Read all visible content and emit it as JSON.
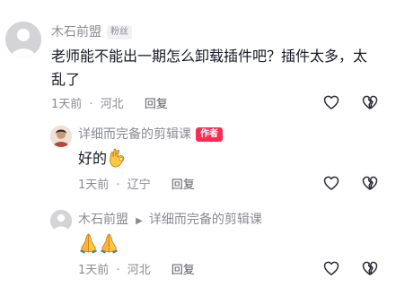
{
  "comments": [
    {
      "user": "木石前盟",
      "badge": "粉丝",
      "text_line1": "老师能不能出一期怎么卸载插件吧？插件太多，太",
      "text_line2": "乱了",
      "time": "1天前",
      "sep": "·",
      "location": "河北",
      "reply_label": "回复"
    }
  ],
  "replies": [
    {
      "user": "详细而完备的剪辑课",
      "badge": "作者",
      "text": "好的",
      "emoji": "ok-hand-emoji",
      "time": "1天前",
      "sep": "·",
      "location": "辽宁",
      "reply_label": "回复"
    },
    {
      "user": "木石前盟",
      "arrow": "▶",
      "reply_to": "详细而完备的剪辑课",
      "emoji": "praying-hands-emoji",
      "time": "1天前",
      "sep": "·",
      "location": "河北",
      "reply_label": "回复"
    }
  ],
  "icons": {
    "like": "heart-outline-icon",
    "dislike": "broken-heart-outline-icon"
  },
  "colors": {
    "author_badge": "#fe2c55",
    "meta_text": "#8a8b91",
    "main_text": "#161823",
    "emoji_yellow": "#ffc83d"
  }
}
